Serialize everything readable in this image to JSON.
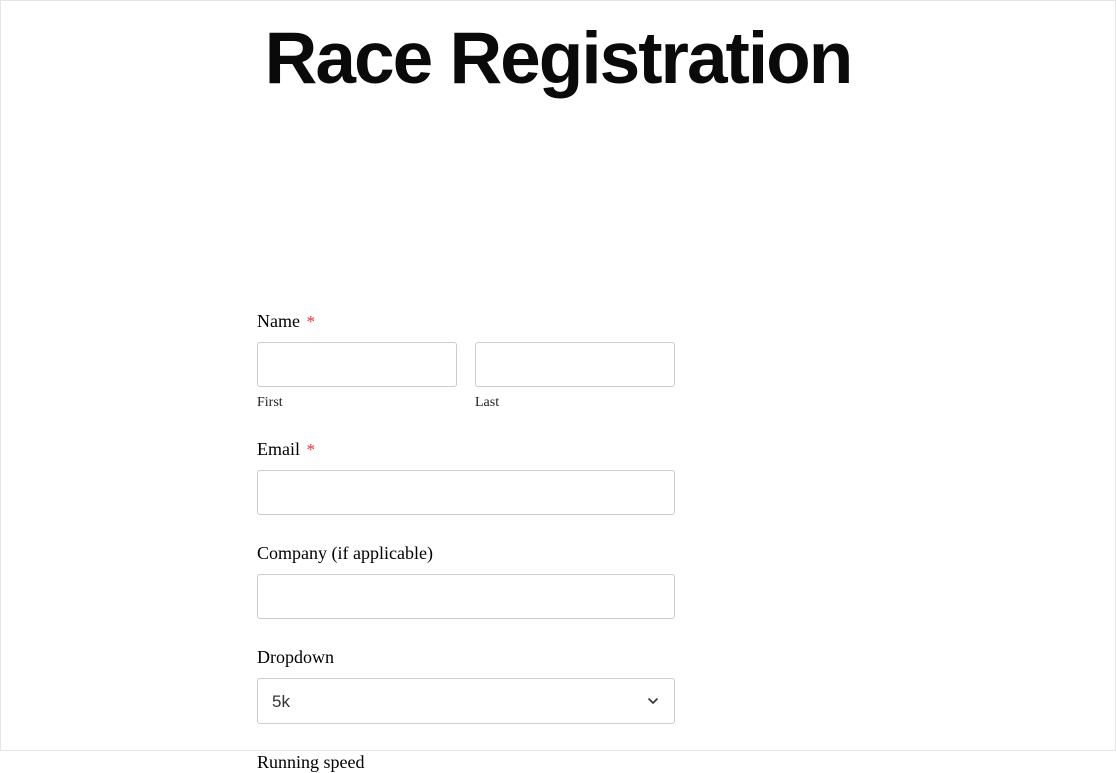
{
  "page": {
    "title": "Race Registration"
  },
  "form": {
    "name": {
      "label": "Name",
      "required_mark": "*",
      "first_sub": "First",
      "last_sub": "Last",
      "first_value": "",
      "last_value": ""
    },
    "email": {
      "label": "Email",
      "required_mark": "*",
      "value": ""
    },
    "company": {
      "label": "Company (if applicable)",
      "value": ""
    },
    "dropdown": {
      "label": "Dropdown",
      "selected": "5k"
    },
    "running_speed": {
      "label": "Running speed"
    }
  }
}
